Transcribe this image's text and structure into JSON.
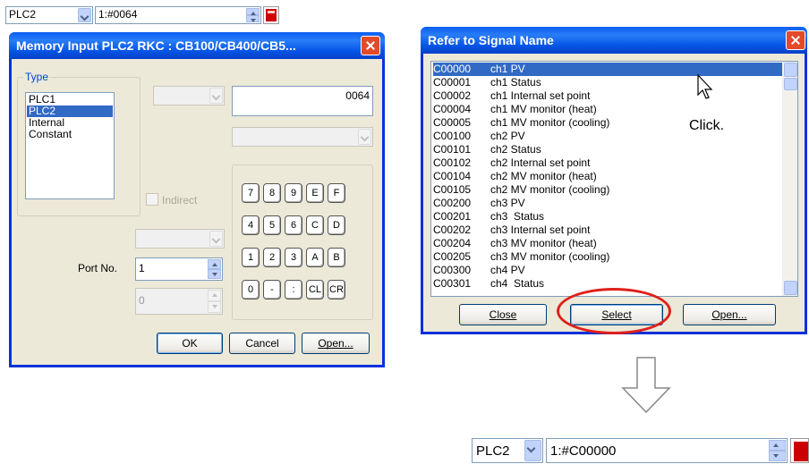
{
  "top_toolbar": {
    "plc_value": "PLC2",
    "address_value": "1:#0064"
  },
  "memory_dialog": {
    "title": "Memory Input  PLC2 RKC : CB100/CB400/CB5...",
    "type_group_label": "Type",
    "type_items": [
      "PLC1",
      "PLC2",
      "Internal",
      "Constant"
    ],
    "selected_type_index": 1,
    "address_input": "0064",
    "indirect_label": "Indirect",
    "port_label": "Port No.",
    "port_value": "1",
    "disabled_value": "0",
    "keypad": [
      [
        "7",
        "8",
        "9",
        "E",
        "F"
      ],
      [
        "4",
        "5",
        "6",
        "C",
        "D"
      ],
      [
        "1",
        "2",
        "3",
        "A",
        "B"
      ],
      [
        "0",
        "-",
        ":",
        "CL",
        "CR"
      ]
    ],
    "ok_label": "OK",
    "cancel_label": "Cancel",
    "open_label": "Open..."
  },
  "signal_dialog": {
    "title": "Refer to Signal Name",
    "signals": [
      {
        "code": "C00000",
        "name": "ch1 PV"
      },
      {
        "code": "C00001",
        "name": "ch1 Status"
      },
      {
        "code": "C00002",
        "name": "ch1 Internal set point"
      },
      {
        "code": "C00004",
        "name": "ch1 MV monitor (heat)"
      },
      {
        "code": "C00005",
        "name": "ch1 MV monitor (cooling)"
      },
      {
        "code": "C00100",
        "name": "ch2 PV"
      },
      {
        "code": "C00101",
        "name": "ch2 Status"
      },
      {
        "code": "C00102",
        "name": "ch2 Internal set point"
      },
      {
        "code": "C00104",
        "name": "ch2 MV monitor (heat)"
      },
      {
        "code": "C00105",
        "name": "ch2 MV monitor (cooling)"
      },
      {
        "code": "C00200",
        "name": "ch3 PV"
      },
      {
        "code": "C00201",
        "name": "ch3  Status"
      },
      {
        "code": "C00202",
        "name": "ch3 Internal set point"
      },
      {
        "code": "C00204",
        "name": "ch3 MV monitor (heat)"
      },
      {
        "code": "C00205",
        "name": "ch3 MV monitor (cooling)"
      },
      {
        "code": "C00300",
        "name": "ch4 PV"
      },
      {
        "code": "C00301",
        "name": "ch4  Status"
      }
    ],
    "selected_index": 0,
    "close_label": "Close",
    "select_label": "Select",
    "open_label": "Open..."
  },
  "annotation": {
    "click_text": "Click.",
    "highlight_color": "#e0201a"
  },
  "bottom_toolbar": {
    "plc_value": "PLC2",
    "address_value": "1:#C00000"
  }
}
